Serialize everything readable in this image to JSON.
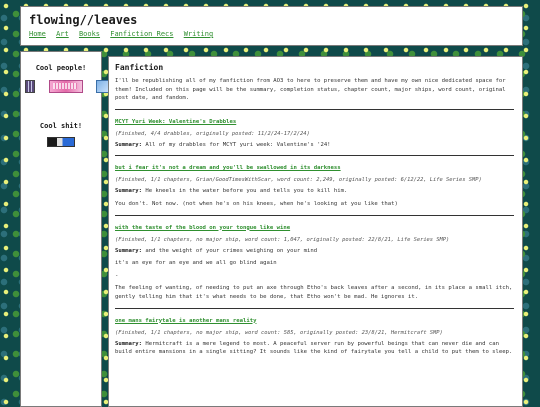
{
  "header": {
    "title": "flowing//leaves",
    "nav": [
      "Home",
      "Art",
      "Books",
      "Fanfiction Recs",
      "Writing"
    ]
  },
  "sidebar": {
    "cool_people_heading": "Cool people!",
    "cool_shit_heading": "Cool shit!"
  },
  "main": {
    "page_title": "Fanfiction",
    "intro": "I'll be republishing all of my fanfiction from AO3 to here to preserve them and have my own nice dedicated space for them! Included on this page will be the summary, completion status, chapter count, major ships, word count, original post date, and fandom.",
    "summary_label": "Summary:",
    "fics": [
      {
        "title": "MCYT Yuri Week: Valentine's Drabbles",
        "meta": "(Finished, 4/4 drabbles, originally posted: 11/2/24-17/2/24)",
        "summary": "All of my drabbles for MCYT yuri week: Valentine's '24!",
        "lines": []
      },
      {
        "title": "but i fear it's not a dream and you'll be swallowed in its darkness",
        "meta": "(Finished, 1/1 chapters, Grian/GoodTimesWithScar, word count: 2,249, originally posted: 6/12/22, Life Series SMP)",
        "summary": "He kneels in the water before you and tells you to kill him.",
        "lines": [
          "You don't. Not now. (not when he's on his knees, when he's looking at you like that)"
        ]
      },
      {
        "title": "with the taste of the blood on your tongue like wine",
        "meta": "(Finished, 1/1 chapters, no major ship, word count: 1,047, originally posted: 22/8/21, Life Series SMP)",
        "summary": "and the weight of your crimes weighing on your mind",
        "lines": [
          "it's an eye for an eye and we all go blind again",
          "-",
          "The feeling of wanting, of needing to put an axe through Etho's back leaves after a second, in its place a small itch, gently telling him that it's what needs to be done, that Etho won't be mad. He ignores it."
        ]
      },
      {
        "title": "one mans fairytale is another mans reality",
        "meta": "(Finished, 1/1 chapters, no major ship, word count: 585, originally posted: 23/8/21, Hermitcraft SMP)",
        "summary": "Hermitcraft is a mere legend to most. A peaceful server run by powerful beings that can never die and can build entire mansions in a single sitting? It sounds like the kind of fairytale you tell a child to put them to sleep.",
        "lines": []
      }
    ]
  },
  "colors": {
    "background": "#0f4a4a",
    "link": "#2f8f2f",
    "panel": "#ffffff"
  }
}
